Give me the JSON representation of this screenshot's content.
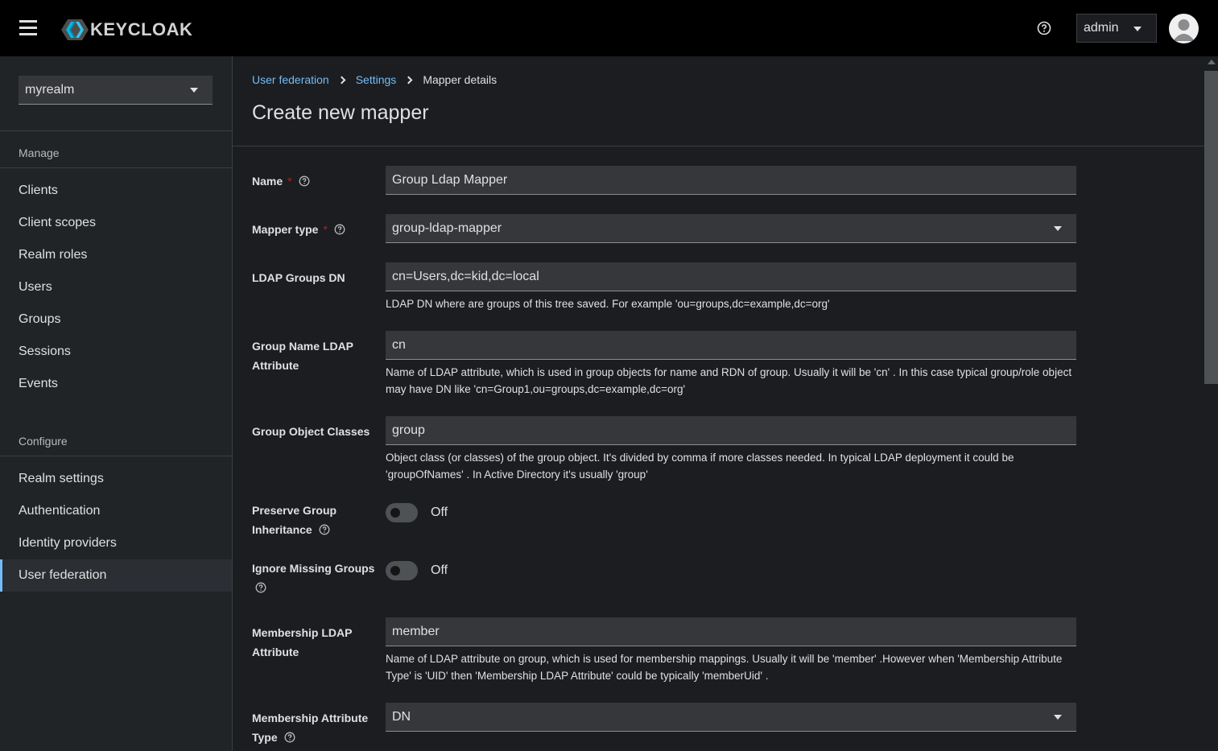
{
  "header": {
    "brand": "KEYCLOAK",
    "user_menu_label": "admin",
    "icons": [
      "hamburger-icon",
      "keycloak-logo",
      "help-icon",
      "caret-down-icon",
      "user-avatar-icon"
    ]
  },
  "sidebar": {
    "realm": "myrealm",
    "manage_heading": "Manage",
    "manage_items": [
      "Clients",
      "Client scopes",
      "Realm roles",
      "Users",
      "Groups",
      "Sessions",
      "Events"
    ],
    "configure_heading": "Configure",
    "configure_items": [
      "Realm settings",
      "Authentication",
      "Identity providers",
      "User federation"
    ],
    "active_item": "User federation",
    "accent_color": "#73bcf7"
  },
  "breadcrumb": {
    "items": [
      "User federation",
      "Settings"
    ],
    "current": "Mapper details"
  },
  "page": {
    "title": "Create new mapper"
  },
  "form": {
    "name": {
      "label": "Name",
      "required_mark": "*",
      "value": "Group Ldap Mapper"
    },
    "mapper_type": {
      "label": "Mapper type",
      "required_mark": "*",
      "value": "group-ldap-mapper"
    },
    "ldap_groups_dn": {
      "label": "LDAP Groups DN",
      "value": "cn=Users,dc=kid,dc=local",
      "help": "LDAP DN where are groups of this tree saved. For example 'ou=groups,dc=example,dc=org'"
    },
    "group_name_attr": {
      "label": "Group Name LDAP Attribute",
      "value": "cn",
      "help": "Name of LDAP attribute, which is used in group objects for name and RDN of group. Usually it will be 'cn' . In this case typical group/role object may have DN like 'cn=Group1,ou=groups,dc=example,dc=org'"
    },
    "group_object_classes": {
      "label": "Group Object Classes",
      "value": "group",
      "help": "Object class (or classes) of the group object. It's divided by comma if more classes needed. In typical LDAP deployment it could be 'groupOfNames' . In Active Directory it's usually 'group'"
    },
    "preserve_inheritance": {
      "label": "Preserve Group Inheritance",
      "state": "Off"
    },
    "ignore_missing": {
      "label": "Ignore Missing Groups",
      "state": "Off"
    },
    "membership_attr": {
      "label": "Membership LDAP Attribute",
      "value": "member",
      "help": "Name of LDAP attribute on group, which is used for membership mappings. Usually it will be 'member' .However when 'Membership Attribute Type' is 'UID' then 'Membership LDAP Attribute' could be typically 'memberUid' ."
    },
    "membership_type": {
      "label": "Membership Attribute Type",
      "value": "DN"
    }
  }
}
